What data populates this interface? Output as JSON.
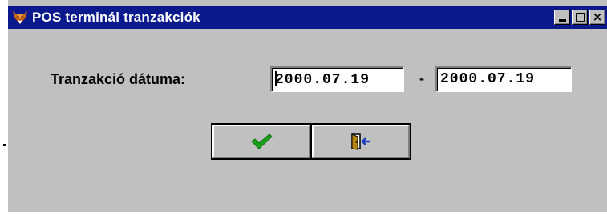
{
  "window": {
    "title": "POS terminál tranzakciók",
    "app_icon": "fox-head-icon",
    "controls": {
      "minimize": "minimize-icon",
      "maximize": "maximize-icon",
      "close": "close-icon"
    },
    "colors": {
      "titlebar": "#0a1a8c",
      "face": "#c0c0c0"
    }
  },
  "form": {
    "date_label": "Tranzakció dátuma:",
    "date_from": "2000.07.19",
    "range_separator": "-",
    "date_to": "2000.07.19"
  },
  "buttons": {
    "ok_icon": "checkmark-icon",
    "exit_icon": "exit-door-icon",
    "ok_color": "#1aa31a",
    "exit_color": "#1f3fbf"
  }
}
